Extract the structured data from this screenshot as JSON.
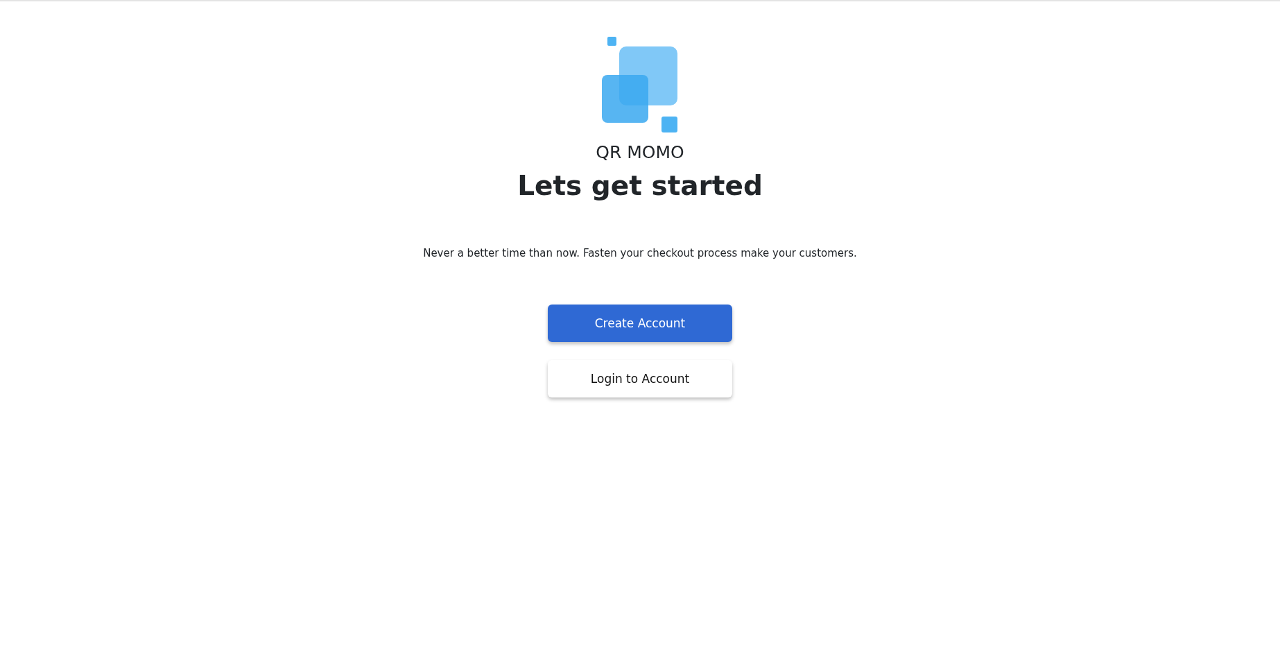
{
  "brand": {
    "name": "QR MOMO"
  },
  "heading": "Lets get started",
  "description": "Never a better time than now. Fasten your checkout process make your customers.",
  "buttons": [
    {
      "label": "Create Account",
      "kind": "primary"
    },
    {
      "label": "Login to Account",
      "kind": "secondary"
    }
  ]
}
